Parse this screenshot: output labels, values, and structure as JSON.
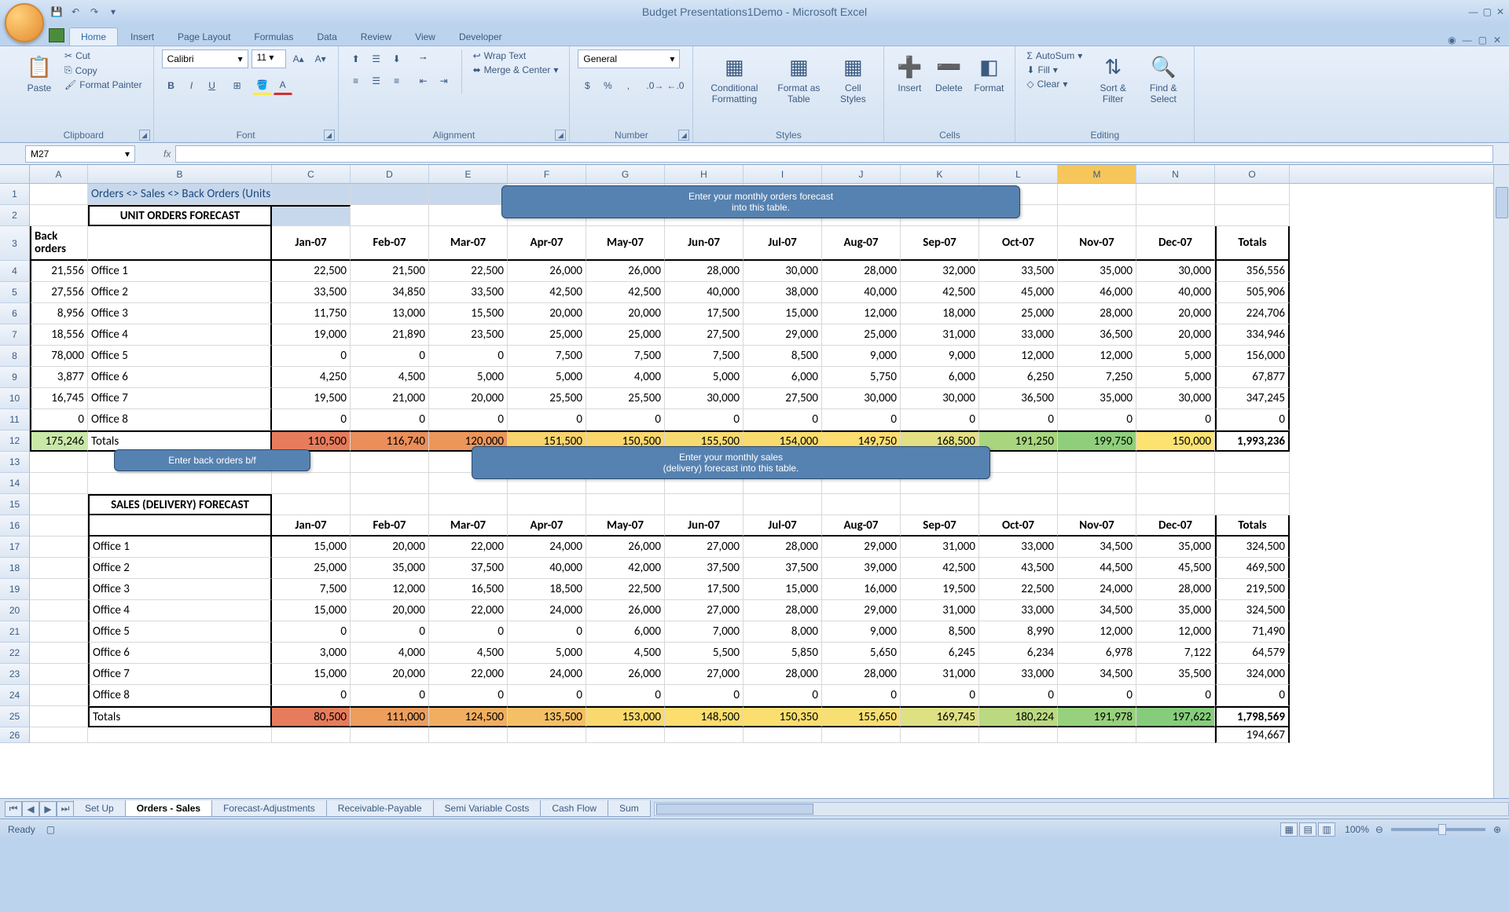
{
  "title": "Budget Presentations1Demo - Microsoft Excel",
  "tabs": [
    "Home",
    "Insert",
    "Page Layout",
    "Formulas",
    "Data",
    "Review",
    "View",
    "Developer"
  ],
  "activeTab": "Home",
  "clipboard": {
    "paste": "Paste",
    "cut": "Cut",
    "copy": "Copy",
    "fmtpainter": "Format Painter",
    "group": "Clipboard"
  },
  "font": {
    "name": "Calibri",
    "size": "11",
    "group": "Font"
  },
  "alignment": {
    "wrap": "Wrap Text",
    "merge": "Merge & Center",
    "group": "Alignment"
  },
  "number": {
    "format": "General",
    "group": "Number"
  },
  "styles": {
    "cond": "Conditional Formatting",
    "fmt": "Format as Table",
    "cell": "Cell Styles",
    "group": "Styles"
  },
  "cells": {
    "insert": "Insert",
    "delete": "Delete",
    "format": "Format",
    "group": "Cells"
  },
  "editing": {
    "autosum": "AutoSum",
    "fill": "Fill",
    "clear": "Clear",
    "sort": "Sort & Filter",
    "find": "Find & Select",
    "group": "Editing"
  },
  "namebox": "M27",
  "sheet": {
    "heading": "Orders <> Sales <> Back Orders (Units)",
    "title1": "UNIT ORDERS FORECAST",
    "title2": "SALES (DELIVERY) FORECAST",
    "backorders_hdr": "Back orders",
    "months": [
      "Jan-07",
      "Feb-07",
      "Mar-07",
      "Apr-07",
      "May-07",
      "Jun-07",
      "Jul-07",
      "Aug-07",
      "Sep-07",
      "Oct-07",
      "Nov-07",
      "Dec-07"
    ],
    "totals_hdr": "Totals",
    "tip1a": "Enter your monthly orders forecast",
    "tip1b": "into this table.",
    "tip2": "Enter back orders b/f",
    "tip3a": "Enter your monthly sales",
    "tip3b": "(delivery) forecast into this table.",
    "orders": {
      "back": [
        "21,556",
        "27,556",
        "8,956",
        "18,556",
        "78,000",
        "3,877",
        "16,745",
        "0"
      ],
      "back_total": "175,246",
      "rows": [
        {
          "name": "Office 1",
          "v": [
            "22,500",
            "21,500",
            "22,500",
            "26,000",
            "26,000",
            "28,000",
            "30,000",
            "28,000",
            "32,000",
            "33,500",
            "35,000",
            "30,000"
          ],
          "t": "356,556"
        },
        {
          "name": "Office 2",
          "v": [
            "33,500",
            "34,850",
            "33,500",
            "42,500",
            "42,500",
            "40,000",
            "38,000",
            "40,000",
            "42,500",
            "45,000",
            "46,000",
            "40,000"
          ],
          "t": "505,906"
        },
        {
          "name": "Office 3",
          "v": [
            "11,750",
            "13,000",
            "15,500",
            "20,000",
            "20,000",
            "17,500",
            "15,000",
            "12,000",
            "18,000",
            "25,000",
            "28,000",
            "20,000"
          ],
          "t": "224,706"
        },
        {
          "name": "Office 4",
          "v": [
            "19,000",
            "21,890",
            "23,500",
            "25,000",
            "25,000",
            "27,500",
            "29,000",
            "25,000",
            "31,000",
            "33,000",
            "36,500",
            "20,000"
          ],
          "t": "334,946"
        },
        {
          "name": "Office 5",
          "v": [
            "0",
            "0",
            "0",
            "7,500",
            "7,500",
            "7,500",
            "8,500",
            "9,000",
            "9,000",
            "12,000",
            "12,000",
            "5,000"
          ],
          "t": "156,000"
        },
        {
          "name": "Office 6",
          "v": [
            "4,250",
            "4,500",
            "5,000",
            "5,000",
            "4,000",
            "5,000",
            "6,000",
            "5,750",
            "6,000",
            "6,250",
            "7,250",
            "5,000"
          ],
          "t": "67,877"
        },
        {
          "name": "Office 7",
          "v": [
            "19,500",
            "21,000",
            "20,000",
            "25,500",
            "25,500",
            "30,000",
            "27,500",
            "30,000",
            "30,000",
            "36,500",
            "35,000",
            "30,000"
          ],
          "t": "347,245"
        },
        {
          "name": "Office 8",
          "v": [
            "0",
            "0",
            "0",
            "0",
            "0",
            "0",
            "0",
            "0",
            "0",
            "0",
            "0",
            "0"
          ],
          "t": "0"
        }
      ],
      "totals": {
        "name": "Totals",
        "v": [
          "110,500",
          "116,740",
          "120,000",
          "151,500",
          "150,500",
          "155,500",
          "154,000",
          "149,750",
          "168,500",
          "191,250",
          "199,750",
          "150,000"
        ],
        "t": "1,993,236"
      }
    },
    "sales": {
      "rows": [
        {
          "name": "Office 1",
          "v": [
            "15,000",
            "20,000",
            "22,000",
            "24,000",
            "26,000",
            "27,000",
            "28,000",
            "29,000",
            "31,000",
            "33,000",
            "34,500",
            "35,000"
          ],
          "t": "324,500"
        },
        {
          "name": "Office 2",
          "v": [
            "25,000",
            "35,000",
            "37,500",
            "40,000",
            "42,000",
            "37,500",
            "37,500",
            "39,000",
            "42,500",
            "43,500",
            "44,500",
            "45,500"
          ],
          "t": "469,500"
        },
        {
          "name": "Office 3",
          "v": [
            "7,500",
            "12,000",
            "16,500",
            "18,500",
            "22,500",
            "17,500",
            "15,000",
            "16,000",
            "19,500",
            "22,500",
            "24,000",
            "28,000"
          ],
          "t": "219,500"
        },
        {
          "name": "Office 4",
          "v": [
            "15,000",
            "20,000",
            "22,000",
            "24,000",
            "26,000",
            "27,000",
            "28,000",
            "29,000",
            "31,000",
            "33,000",
            "34,500",
            "35,000"
          ],
          "t": "324,500"
        },
        {
          "name": "Office 5",
          "v": [
            "0",
            "0",
            "0",
            "0",
            "6,000",
            "7,000",
            "8,000",
            "9,000",
            "8,500",
            "8,990",
            "12,000",
            "12,000"
          ],
          "t": "71,490"
        },
        {
          "name": "Office 6",
          "v": [
            "3,000",
            "4,000",
            "4,500",
            "5,000",
            "4,500",
            "5,500",
            "5,850",
            "5,650",
            "6,245",
            "6,234",
            "6,978",
            "7,122"
          ],
          "t": "64,579"
        },
        {
          "name": "Office 7",
          "v": [
            "15,000",
            "20,000",
            "22,000",
            "24,000",
            "26,000",
            "27,000",
            "28,000",
            "28,000",
            "31,000",
            "33,000",
            "34,500",
            "35,500"
          ],
          "t": "324,000"
        },
        {
          "name": "Office 8",
          "v": [
            "0",
            "0",
            "0",
            "0",
            "0",
            "0",
            "0",
            "0",
            "0",
            "0",
            "0",
            "0"
          ],
          "t": "0"
        }
      ],
      "totals": {
        "name": "Totals",
        "v": [
          "80,500",
          "111,000",
          "124,500",
          "135,500",
          "153,000",
          "148,500",
          "150,350",
          "155,650",
          "169,745",
          "180,224",
          "191,978",
          "197,622"
        ],
        "t": "1,798,569"
      },
      "extra": "194,667"
    }
  },
  "sheettabs": [
    "Set Up",
    "Orders - Sales",
    "Forecast-Adjustments",
    "Receivable-Payable",
    "Semi Variable Costs",
    "Cash Flow",
    "Sum"
  ],
  "activeSheet": "Orders - Sales",
  "status": "Ready",
  "zoom": "100%"
}
